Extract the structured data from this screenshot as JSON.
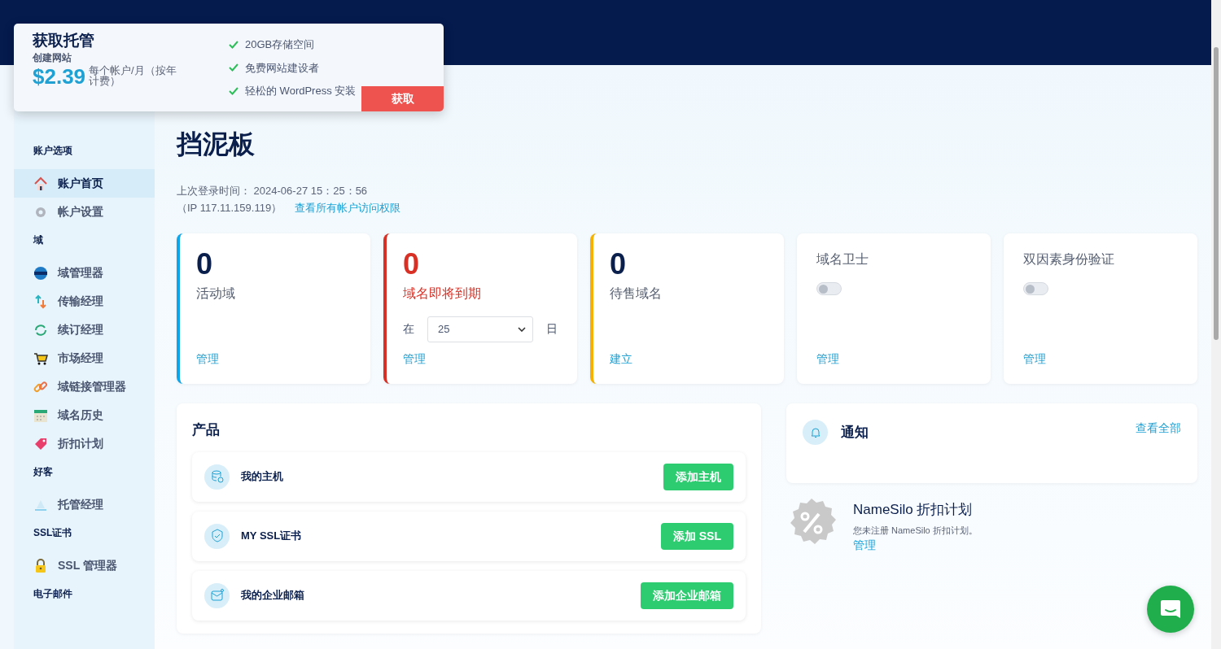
{
  "promo": {
    "title": "获取托管",
    "subtitle": "创建网站",
    "price": "$2.39",
    "price_note": "每个帐户/月（按年计费）",
    "features": [
      "20GB存储空间",
      "免费网站建设者",
      "轻松的 WordPress 安装"
    ],
    "button": "获取"
  },
  "sidebar": {
    "sections": [
      {
        "heading": "账户选项",
        "items": [
          {
            "label": "账户首页",
            "selected": true
          },
          {
            "label": "帐户设置",
            "selected": false
          }
        ]
      },
      {
        "heading": "域",
        "items": [
          {
            "label": "域管理器",
            "selected": false
          },
          {
            "label": "传输经理",
            "selected": false
          },
          {
            "label": "续订经理",
            "selected": false
          },
          {
            "label": "市场经理",
            "selected": false
          },
          {
            "label": "域链接管理器",
            "selected": false
          },
          {
            "label": "域名历史",
            "selected": false
          },
          {
            "label": "折扣计划",
            "selected": false
          }
        ]
      },
      {
        "heading": "好客",
        "items": [
          {
            "label": "托管经理",
            "selected": false
          }
        ]
      },
      {
        "heading": "SSL证书",
        "items": [
          {
            "label": "SSL 管理器",
            "selected": false
          }
        ]
      },
      {
        "heading": "电子邮件"
      }
    ]
  },
  "page": {
    "title": "挡泥板",
    "last_login": "上次登录时间：  2024-06-27 15：25：56",
    "ip": "（IP 117.11.159.119）",
    "access_link": "查看所有帐户访问权限"
  },
  "stats": [
    {
      "kind": "count",
      "value": "0",
      "label": "活动域",
      "color": "#0ea5e9",
      "link": "管理"
    },
    {
      "kind": "count",
      "value": "0",
      "label": "域名即将到期",
      "color": "#d93025",
      "select": {
        "prefix": "在",
        "value": "25",
        "suffix": "日"
      },
      "link": "管理"
    },
    {
      "kind": "count",
      "value": "0",
      "label": "待售域名",
      "color": "#f5b000",
      "link": "建立"
    },
    {
      "kind": "toggle",
      "label": "域名卫士",
      "on": false,
      "link": "管理"
    },
    {
      "kind": "toggle",
      "label": "双因素身份验证",
      "on": false,
      "link": "管理"
    }
  ],
  "products": {
    "title": "产品",
    "items": [
      {
        "name": "我的主机",
        "button": "添加主机"
      },
      {
        "name": "MY SSL证书",
        "button": "添加 SSL"
      },
      {
        "name": "我的企业邮箱",
        "button": "添加企业邮箱"
      }
    ]
  },
  "notifications": {
    "title": "通知",
    "link": "查看全部"
  },
  "discount": {
    "title": "NameSilo 折扣计划",
    "text": "您未注册 NameSilo 折扣计划。",
    "link": "管理"
  }
}
